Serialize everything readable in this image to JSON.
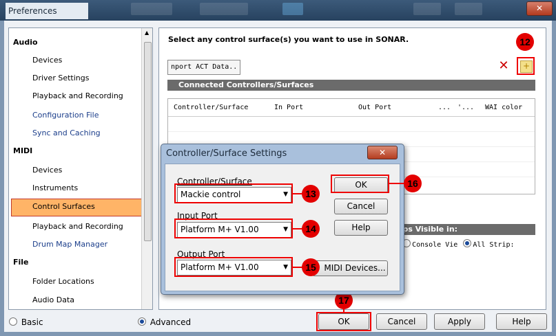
{
  "window": {
    "title": "Preferences",
    "close_glyph": "✕"
  },
  "tree": {
    "items": [
      {
        "label": "Audio",
        "type": "category"
      },
      {
        "label": "Devices",
        "type": "item"
      },
      {
        "label": "Driver Settings",
        "type": "item"
      },
      {
        "label": "Playback and Recording",
        "type": "item"
      },
      {
        "label": "Configuration File",
        "type": "link"
      },
      {
        "label": "Sync and Caching",
        "type": "link"
      },
      {
        "label": "MIDI",
        "type": "category"
      },
      {
        "label": "Devices",
        "type": "item"
      },
      {
        "label": "Instruments",
        "type": "item"
      },
      {
        "label": "Control Surfaces",
        "type": "selected"
      },
      {
        "label": "Playback and Recording",
        "type": "item"
      },
      {
        "label": "Drum Map Manager",
        "type": "link"
      },
      {
        "label": "File",
        "type": "category"
      },
      {
        "label": "Folder Locations",
        "type": "item"
      },
      {
        "label": "Audio Data",
        "type": "item"
      }
    ]
  },
  "main": {
    "header": "Select any control surface(s) you want to use in SONAR.",
    "import_button": "nport ACT Data..",
    "section_title": "Connected Controllers/Surfaces",
    "columns": [
      "Controller/Surface",
      "In Port",
      "Out Port",
      "...",
      "'...",
      "WAI color"
    ],
    "strips_title": "trips Visible in:",
    "strips_options": [
      "w",
      "Console Vie",
      "All Strip:"
    ]
  },
  "dialog": {
    "title": "Controller/Surface Settings",
    "close_glyph": "✕",
    "controller_label": "Controller/Surface",
    "controller_value": "Mackie control",
    "input_label": "Input Port",
    "input_value": "Platform M+ V1.00",
    "output_label": "Output Port",
    "output_value": "Platform M+ V1.00",
    "ok": "OK",
    "cancel": "Cancel",
    "help": "Help",
    "midi_devices": "MIDI Devices..."
  },
  "bottom": {
    "basic": "Basic",
    "advanced": "Advanced",
    "ok": "OK",
    "cancel": "Cancel",
    "apply": "Apply",
    "help": "Help"
  },
  "callouts": {
    "c12": "12",
    "c13": "13",
    "c14": "14",
    "c15": "15",
    "c16": "16",
    "c17": "17"
  },
  "colors": {
    "highlight": "#e30000",
    "selected": "#ffb467"
  }
}
